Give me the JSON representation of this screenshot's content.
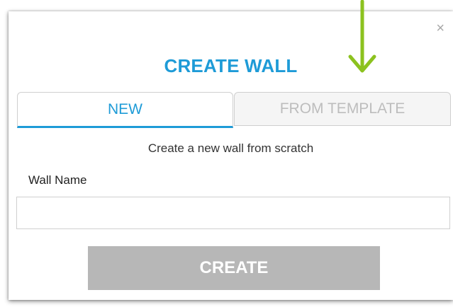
{
  "dialog": {
    "close_glyph": "×",
    "title": "CREATE WALL",
    "tabs": [
      {
        "label": "NEW",
        "active": true
      },
      {
        "label": "FROM TEMPLATE",
        "active": false
      }
    ],
    "subtitle": "Create a new wall from scratch",
    "wall_name": {
      "label": "Wall Name",
      "value": "",
      "placeholder": ""
    },
    "create_label": "CREATE"
  },
  "annotation": {
    "icon": "down-arrow-icon",
    "color": "#8cc21f"
  },
  "colors": {
    "accent": "#1e9bd7",
    "button_disabled": "#b7b7b7",
    "tab_inactive_text": "#bdbdbd"
  }
}
